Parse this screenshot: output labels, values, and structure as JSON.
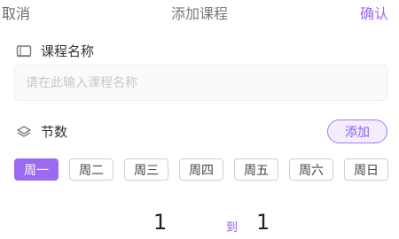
{
  "header": {
    "cancel": "取消",
    "title": "添加课程",
    "confirm": "确认"
  },
  "course_name": {
    "label": "课程名称",
    "icon": "book-icon",
    "placeholder": "请在此输入课程名称",
    "value": ""
  },
  "sections": {
    "label": "节数",
    "icon": "layers-icon",
    "add_label": "添加"
  },
  "days": [
    {
      "label": "周一",
      "selected": true
    },
    {
      "label": "周二",
      "selected": false
    },
    {
      "label": "周三",
      "selected": false
    },
    {
      "label": "周四",
      "selected": false
    },
    {
      "label": "周五",
      "selected": false
    },
    {
      "label": "周六",
      "selected": false
    },
    {
      "label": "周日",
      "selected": false
    }
  ],
  "range": {
    "from": "1",
    "to_label": "到",
    "to": "1"
  },
  "colors": {
    "accent": "#9b6af0",
    "accent_light": "#f3edfe",
    "text": "#333333",
    "muted": "#6b6b6b"
  }
}
